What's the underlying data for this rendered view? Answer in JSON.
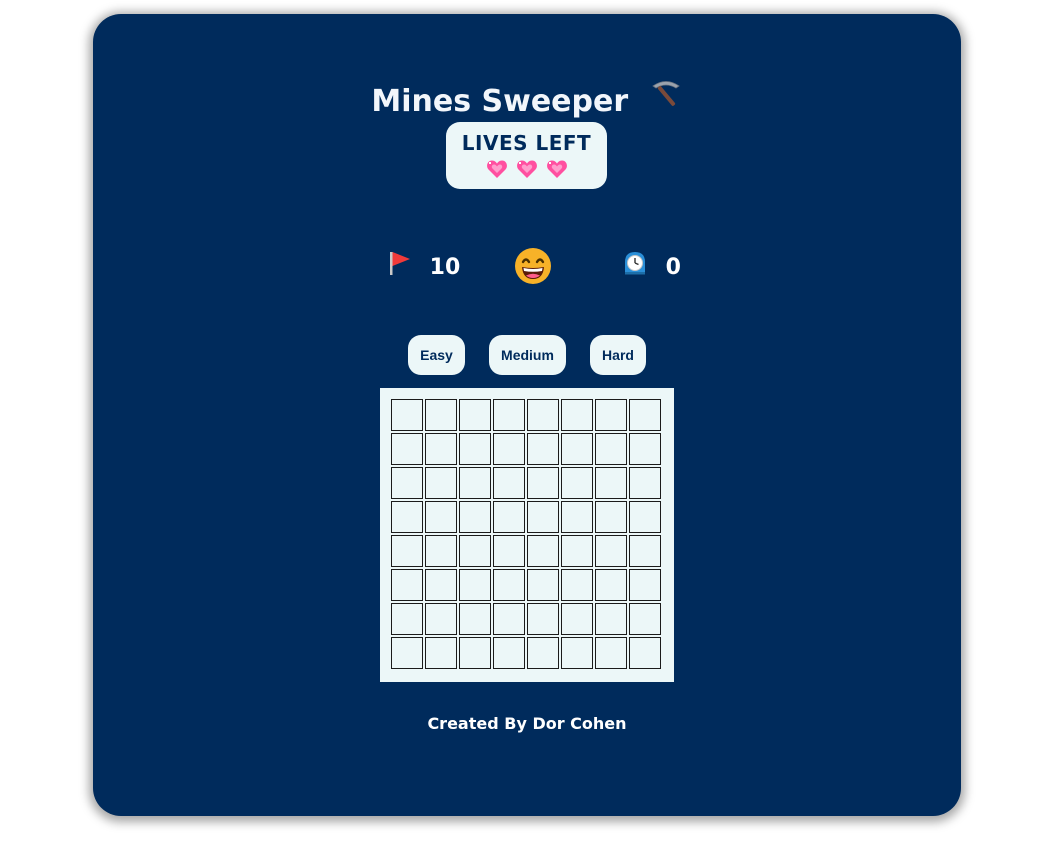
{
  "header": {
    "title": "Mines Sweeper",
    "title_icon": "pickaxe-icon"
  },
  "lives": {
    "label": "LIVES LEFT",
    "count": 3,
    "icon": "heart-icon",
    "heart_color": "#ff4fa0"
  },
  "status": {
    "flags_icon": "flag-icon",
    "flags": "10",
    "smiley_icon": "grinning-face-icon",
    "timer_icon": "clock-icon",
    "time": "0"
  },
  "levels": [
    {
      "label": "Easy"
    },
    {
      "label": "Medium"
    },
    {
      "label": "Hard"
    }
  ],
  "board": {
    "rows": 8,
    "cols": 8
  },
  "footer": {
    "credit": "Created By Dor Cohen"
  },
  "colors": {
    "background": "#002b5c",
    "panel": "#ecf7f8",
    "text_light": "#ffffff"
  }
}
